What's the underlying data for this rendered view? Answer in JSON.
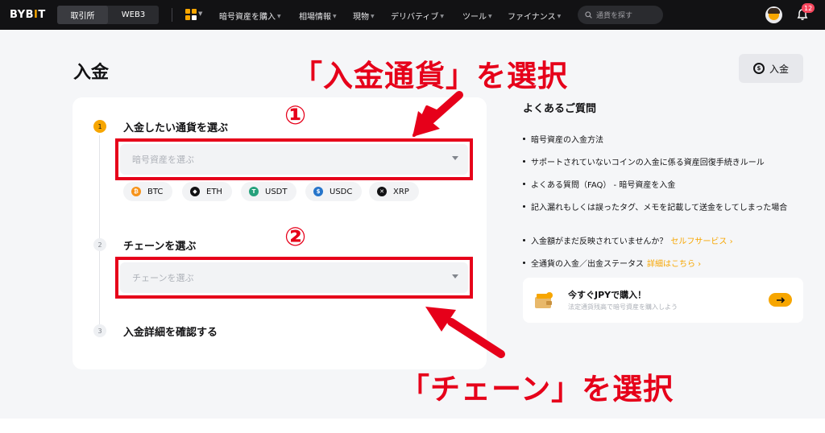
{
  "topbar": {
    "logo_a": "BYB",
    "logo_b": "I",
    "logo_c": "T",
    "tab_exchange": "取引所",
    "tab_web3": "WEB3",
    "nav_items": [
      "暗号資産を購入",
      "相場情報",
      "現物",
      "デリバティブ",
      "ツール",
      "ファイナンス"
    ],
    "search_placeholder": "通貨を探す",
    "notification_count": "12",
    "icons": [
      "grid-icon",
      "search-icon",
      "avatar",
      "bell-icon"
    ]
  },
  "page": {
    "title": "入金",
    "deposit_button": "入金"
  },
  "steps": [
    {
      "num": "1",
      "title": "入金したい通貨を選ぶ",
      "placeholder": "暗号資産を選ぶ"
    },
    {
      "num": "2",
      "title": "チェーンを選ぶ",
      "placeholder": "チェーンを選ぶ"
    },
    {
      "num": "3",
      "title": "入金詳細を確認する"
    }
  ],
  "coins": [
    {
      "symbol": "BTC",
      "color": "#f7931a"
    },
    {
      "symbol": "ETH",
      "color": "#121214"
    },
    {
      "symbol": "USDT",
      "color": "#26a17b"
    },
    {
      "symbol": "USDC",
      "color": "#2775ca"
    },
    {
      "symbol": "XRP",
      "color": "#121214"
    }
  ],
  "faq": {
    "title": "よくあるご質問",
    "items": [
      "暗号資産の入金方法",
      "サポートされていないコインの入金に係る資産回復手続きルール",
      "よくある質問（FAQ） - 暗号資産を入金",
      "記入漏れもしくは誤ったタグ、メモを記載して送金をしてしまった場合"
    ],
    "status_items": [
      {
        "text": "入金額がまだ反映されていませんか？",
        "link": "セルフサービス ›"
      },
      {
        "text": "全通貨の入金／出金ステータス",
        "link": "詳細はこちら ›"
      }
    ]
  },
  "promo": {
    "title": "今すぐJPYで購入！",
    "subtitle": "法定通貨残高で暗号資産を購入しよう"
  },
  "annotations": {
    "currency": "「入金通貨」を選択",
    "chain": "「チェーン」を選択",
    "marker1": "①",
    "marker2": "②"
  },
  "colors": {
    "accent": "#f7a600",
    "annotation_red": "#e6001a",
    "nav_bg": "#121214"
  }
}
